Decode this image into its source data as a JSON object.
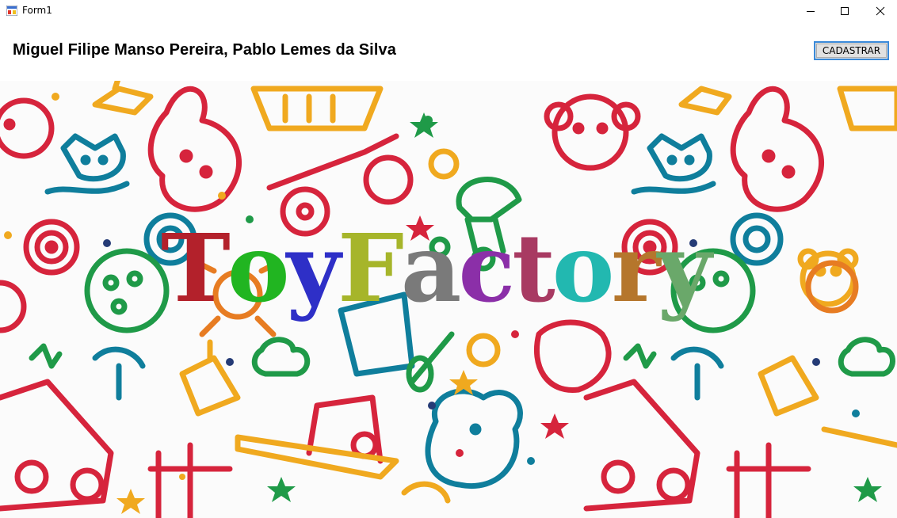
{
  "window": {
    "title": "Form1",
    "icon": "form-icon",
    "controls": [
      "minimize-icon",
      "maximize-icon",
      "close-icon"
    ]
  },
  "header": {
    "authors": "Miguel Filipe Manso Pereira, Pablo Lemes da Silva",
    "cadastrar_label": "CADASTRAR"
  },
  "logo": {
    "letters": [
      {
        "char": "T",
        "color": "#b3212b"
      },
      {
        "char": "o",
        "color": "#21b521"
      },
      {
        "char": "y",
        "color": "#2e2fc7"
      },
      {
        "char": "F",
        "color": "#a6b52a"
      },
      {
        "char": "a",
        "color": "#7a7a7a"
      },
      {
        "char": "c",
        "color": "#8b2fa8"
      },
      {
        "char": "t",
        "color": "#a83a62"
      },
      {
        "char": "o",
        "color": "#22b8b0"
      },
      {
        "char": "r",
        "color": "#b5762c"
      },
      {
        "char": "y",
        "color": "#6aa86a"
      }
    ]
  },
  "background": {
    "description_colors": [
      "#d6243c",
      "#f0a91f",
      "#0f7e9c",
      "#1f9a48",
      "#e77c22",
      "#253b76"
    ]
  }
}
